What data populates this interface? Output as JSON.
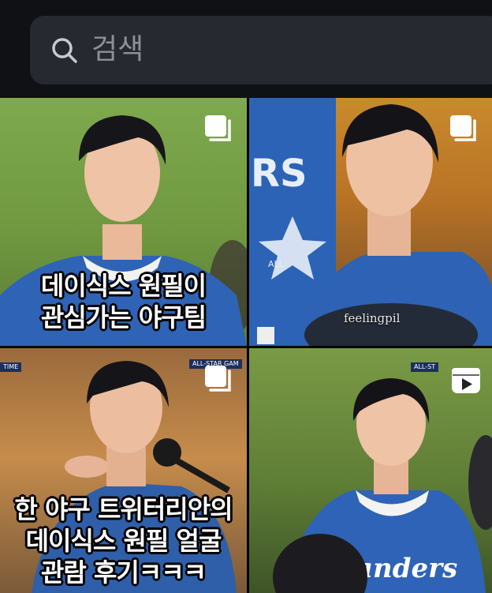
{
  "search": {
    "placeholder": "검색"
  },
  "tiles": [
    {
      "caption": [
        "데이식스 원필이",
        "관심가는 야구팀"
      ],
      "badge": "multiple"
    },
    {
      "watermark": "feelingpil",
      "badge": "multiple"
    },
    {
      "caption": [
        "한 야구 트위터리안의",
        "데이식스 원필 얼굴",
        "관람 후기ㅋㅋㅋ"
      ],
      "badge": "multiple"
    },
    {
      "badge": "video"
    }
  ],
  "scorebugs": [
    "TIME",
    "ALL-STAR GAM",
    "ALL-ST"
  ],
  "jerseys": [
    "RS",
    "anders",
    "ALL"
  ]
}
